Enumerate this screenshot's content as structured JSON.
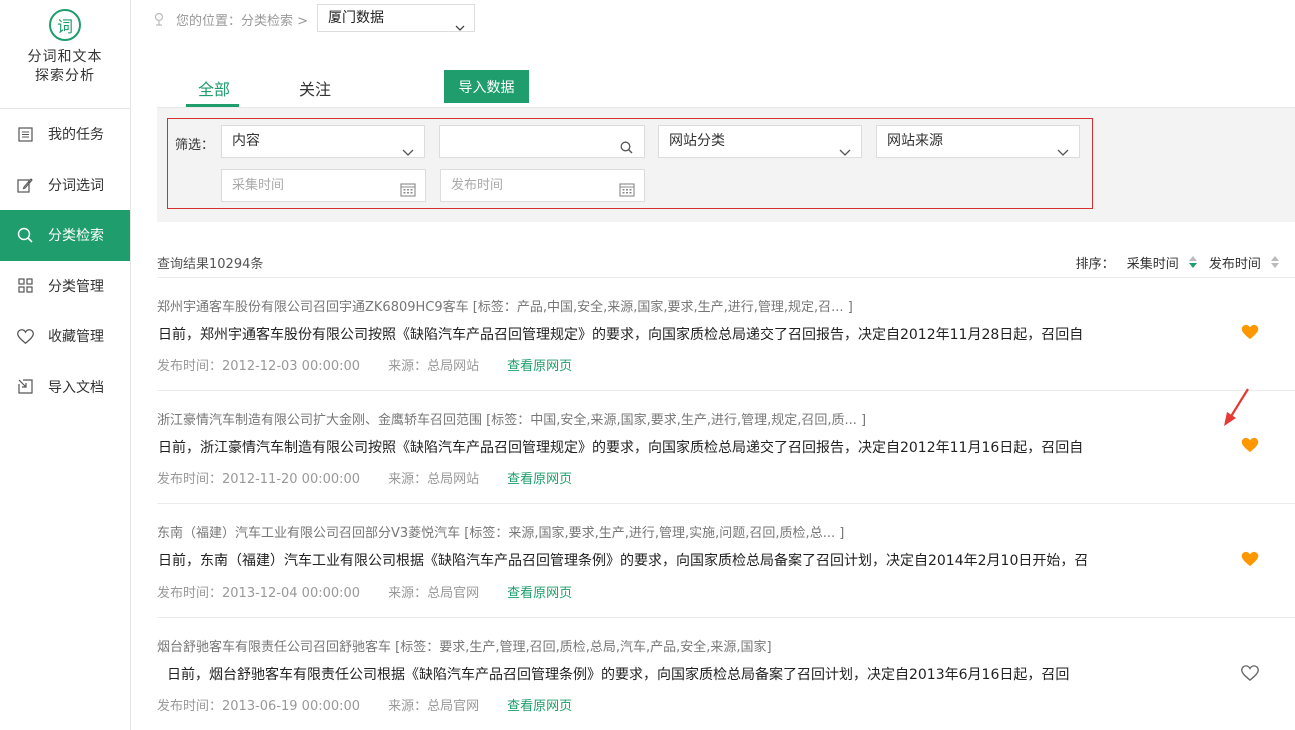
{
  "sidebar": {
    "logo_char": "词",
    "logo_line1": "分词和文本",
    "logo_line2": "探索分析",
    "items": [
      {
        "label": "我的任务",
        "icon": "list-icon"
      },
      {
        "label": "分词选词",
        "icon": "edit-icon"
      },
      {
        "label": "分类检索",
        "icon": "search-icon"
      },
      {
        "label": "分类管理",
        "icon": "grid-icon"
      },
      {
        "label": "收藏管理",
        "icon": "heart-icon"
      },
      {
        "label": "导入文档",
        "icon": "import-icon"
      }
    ],
    "active_index": 2
  },
  "topbar": {
    "breadcrumb": "您的位置：分类检索 >",
    "db_selected": "厦门数据"
  },
  "tabs": {
    "all": "全部",
    "follow": "关注",
    "import_button": "导入数据"
  },
  "filter": {
    "label": "筛选：",
    "content_select": "内容",
    "search_value": "",
    "site_category": "网站分类",
    "site_source": "网站来源",
    "collect_time_placeholder": "采集时间",
    "publish_time_placeholder": "发布时间"
  },
  "results": {
    "count_text": "查询结果10294条",
    "sort_label": "排序：",
    "sort_collect": "采集时间",
    "sort_publish": "发布时间"
  },
  "items": [
    {
      "title": "郑州宇通客车股份有限公司召回宇通ZK6809HC9客车 [标签：产品,中国,安全,来源,国家,要求,生产,进行,管理,规定,召...  ]",
      "body": "日前，郑州宇通客车股份有限公司按照《缺陷汽车产品召回管理规定》的要求，向国家质检总局递交了召回报告，决定自2012年11月28日起，召回自",
      "date": "发布时间：2012-12-03 00:00:00",
      "source": "来源：总局网站",
      "link": "查看原网页",
      "favorited": true
    },
    {
      "title": "浙江豪情汽车制造有限公司扩大金刚、金鹰轿车召回范围 [标签：中国,安全,来源,国家,要求,生产,进行,管理,规定,召回,质...  ]",
      "body": "日前，浙江豪情汽车制造有限公司按照《缺陷汽车产品召回管理规定》的要求，向国家质检总局递交了召回报告，决定自2012年11月16日起，召回自",
      "date": "发布时间：2012-11-20 00:00:00",
      "source": "来源：总局网站",
      "link": "查看原网页",
      "favorited": true
    },
    {
      "title": "东南（福建）汽车工业有限公司召回部分V3菱悦汽车 [标签：来源,国家,要求,生产,进行,管理,实施,问题,召回,质检,总...  ]",
      "body": "日前，东南（福建）汽车工业有限公司根据《缺陷汽车产品召回管理条例》的要求，向国家质检总局备案了召回计划，决定自2014年2月10日开始，召",
      "date": "发布时间：2013-12-04 00:00:00",
      "source": "来源：总局官网",
      "link": "查看原网页",
      "favorited": true
    },
    {
      "title": "烟台舒驰客车有限责任公司召回舒驰客车 [标签：要求,生产,管理,召回,质检,总局,汽车,产品,安全,来源,国家]",
      "body": "日前，烟台舒驰客车有限责任公司根据《缺陷汽车产品召回管理条例》的要求，向国家质检总局备案了召回计划，决定自2013年6月16日起，召回",
      "date": "发布时间：2013-06-19 00:00:00",
      "source": "来源：总局官网",
      "link": "查看原网页",
      "favorited": false
    }
  ],
  "colors": {
    "accent": "#1f9d6c",
    "heart_filled": "#ff9800",
    "highlight_border": "#d32f2f"
  }
}
